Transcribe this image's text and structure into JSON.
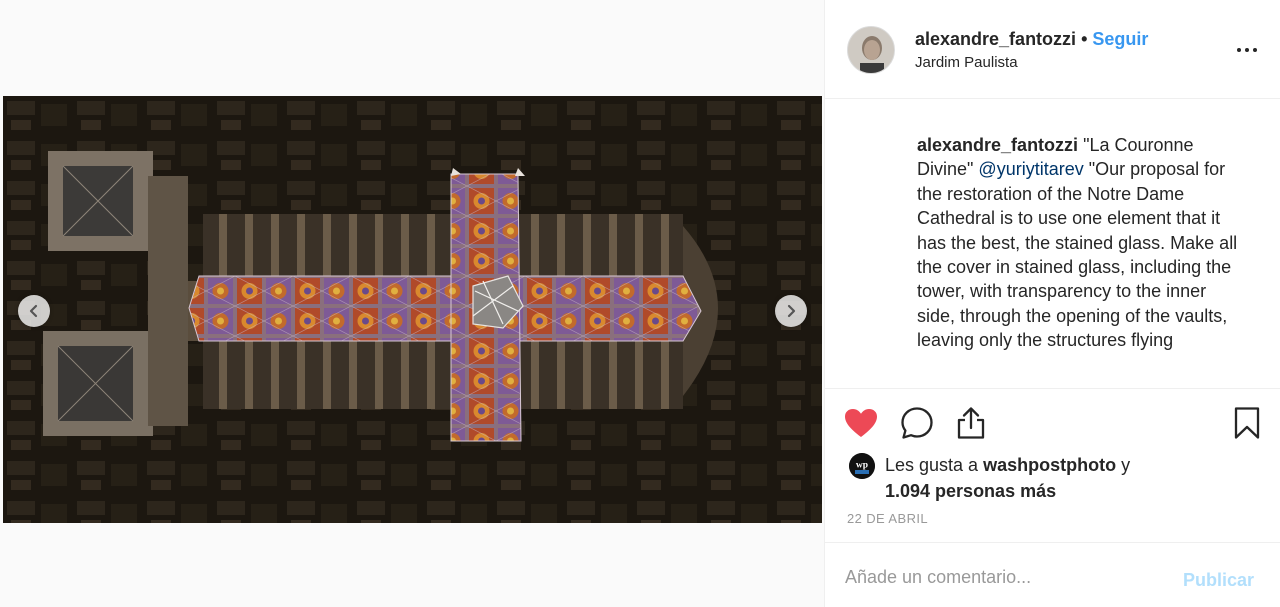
{
  "post": {
    "images_count": 10,
    "active_image_index": 8
  },
  "header": {
    "username": "alexandre_fantozzi",
    "separator": "•",
    "follow_label": "Seguir",
    "location": "Jardim Paulista"
  },
  "caption": {
    "username": "alexandre_fantozzi",
    "text_1": " \"La Couronne Divine\" ",
    "mention": "@yuriytitarev",
    "text_2": " \"Our proposal for the restoration of the Notre Dame Cathedral is to use one element that it has the best, the stained glass. Make all the cover in stained glass, including the tower, with transparency to the inner side, through the opening of the vaults, leaving only the structures flying"
  },
  "likes": {
    "prefix": "Les gusta a ",
    "liker": "washpostphoto",
    "middle": " y ",
    "others": "1.094 personas más",
    "avatar_text": "wp"
  },
  "date": "22 DE ABRIL",
  "comment": {
    "placeholder": "Añade un comentario...",
    "post_label": "Publicar"
  },
  "colors": {
    "accent": "#3897f0",
    "like": "#ed4956",
    "publish_disabled": "#b2dffc"
  }
}
